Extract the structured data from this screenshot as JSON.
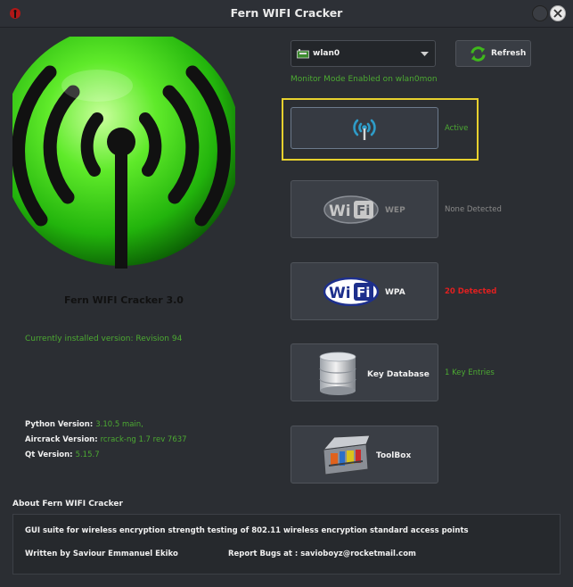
{
  "window": {
    "title": "Fern WIFI Cracker"
  },
  "logo": {
    "version_title": "Fern WIFI Cracker 3.0"
  },
  "installed": {
    "text": "Currently installed version: Revision 94"
  },
  "versions": [
    {
      "label": "Python Version:",
      "value": "3.10.5 main,"
    },
    {
      "label": "Aircrack Version:",
      "value": "rcrack-ng 1.7 rev 7637"
    },
    {
      "label": "Qt Version:",
      "value": "5.15.7"
    }
  ],
  "interface": {
    "selected": "wlan0",
    "refresh_label": "Refresh",
    "monitor_status": "Monitor Mode Enabled on wlan0mon"
  },
  "scan": {
    "status": "Active"
  },
  "wep": {
    "label": "WEP",
    "status": "None Detected"
  },
  "wpa": {
    "label": "WPA",
    "status": "20 Detected"
  },
  "keydb": {
    "label": "Key Database",
    "status": "1 Key Entries"
  },
  "toolbox": {
    "label": "ToolBox"
  },
  "about": {
    "heading": "About Fern WIFI Cracker",
    "description": "GUI suite for wireless  encryption strength testing of 802.11 wireless encryption standard access points",
    "author": "Written by Saviour Emmanuel Ekiko",
    "bugs": "Report Bugs at :  savioboyz@rocketmail.com"
  },
  "colors": {
    "accent_green": "#4caa32",
    "alert_red": "#e02020",
    "highlight_yellow": "#e7d12e"
  },
  "icons": [
    "app-icon",
    "network-adapter-icon",
    "chevron-down-icon",
    "refresh-icon",
    "wifi-signal-icon",
    "wifi-logo-icon",
    "database-icon",
    "toolbox-icon"
  ]
}
